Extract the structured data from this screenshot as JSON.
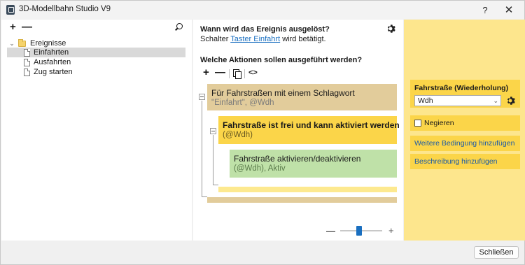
{
  "window": {
    "title": "3D-Modellbahn Studio V9",
    "help_label": "?",
    "close_label": "✕"
  },
  "left": {
    "add_label": "+",
    "remove_label": "—",
    "tree": {
      "root_label": "Ereignisse",
      "items": [
        {
          "label": "Einfahrten",
          "selected": true
        },
        {
          "label": "Ausfahrten",
          "selected": false
        },
        {
          "label": "Zug starten",
          "selected": false
        }
      ]
    }
  },
  "middle": {
    "trigger_question": "Wann wird das Ereignis ausgelöst?",
    "trigger_prefix": "Schalter ",
    "trigger_link": "Taster Einfahrt",
    "trigger_suffix": " wird betätigt.",
    "actions_question": "Welche Aktionen sollen ausgeführt werden?",
    "toolbar": {
      "add_label": "+",
      "remove_label": "—",
      "code_label": "<>"
    },
    "blocks": [
      {
        "title": "Für Fahrstraßen mit einem Schlagwort",
        "subtitle": "\"Einfahrt\", @Wdh",
        "color": "#e2cc9b"
      },
      {
        "title": "Fahrstraße ist frei und kann aktiviert werden",
        "subtitle": "(@Wdh)",
        "color": "#fbd549"
      },
      {
        "title": "Fahrstraße aktivieren/deaktivieren",
        "subtitle": "(@Wdh), Aktiv",
        "color": "#bfe1a8"
      }
    ],
    "zoom": {
      "minus_label": "—",
      "plus_label": "+",
      "level": 0.45
    }
  },
  "right": {
    "section_label": "Fahrstraße (Wiederholung)",
    "select_value": "Wdh",
    "negate_label": "Negieren",
    "negate_checked": false,
    "add_condition_label": "Weitere Bedingung hinzufügen",
    "add_description_label": "Beschreibung hinzufügen"
  },
  "footer": {
    "close_button_label": "Schließen"
  },
  "colors": {
    "accent": "#1a6fc0",
    "panel_yellow": "#fde68d",
    "card_yellow": "#fbd549"
  }
}
